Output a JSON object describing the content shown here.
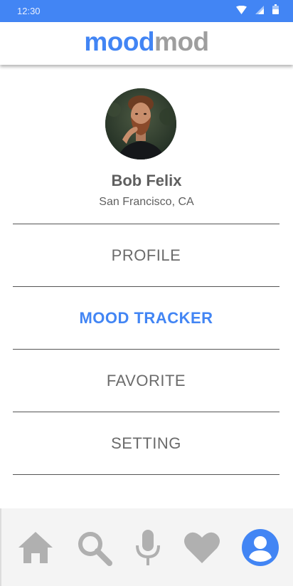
{
  "status_bar": {
    "time": "12:30",
    "icons": [
      "wifi-icon",
      "signal-icon",
      "battery-icon"
    ]
  },
  "app_bar": {
    "logo_part1": "mood",
    "logo_part2": "mod"
  },
  "profile": {
    "name": "Bob Felix",
    "location": "San Francisco, CA",
    "avatar": "profile-photo"
  },
  "menu": {
    "items": [
      {
        "label": "PROFILE",
        "active": false
      },
      {
        "label": "MOOD TRACKER",
        "active": true
      },
      {
        "label": "FAVORITE",
        "active": false
      },
      {
        "label": "SETTING",
        "active": false
      }
    ]
  },
  "bottom_nav": {
    "items": [
      {
        "icon": "home-icon",
        "active": false
      },
      {
        "icon": "search-icon",
        "active": false
      },
      {
        "icon": "microphone-icon",
        "active": false
      },
      {
        "icon": "heart-icon",
        "active": false
      },
      {
        "icon": "account-icon",
        "active": true
      }
    ]
  },
  "colors": {
    "primary": "#4285f4",
    "secondary_text": "#9e9e9e",
    "inactive_icon": "#b0b0b0"
  }
}
